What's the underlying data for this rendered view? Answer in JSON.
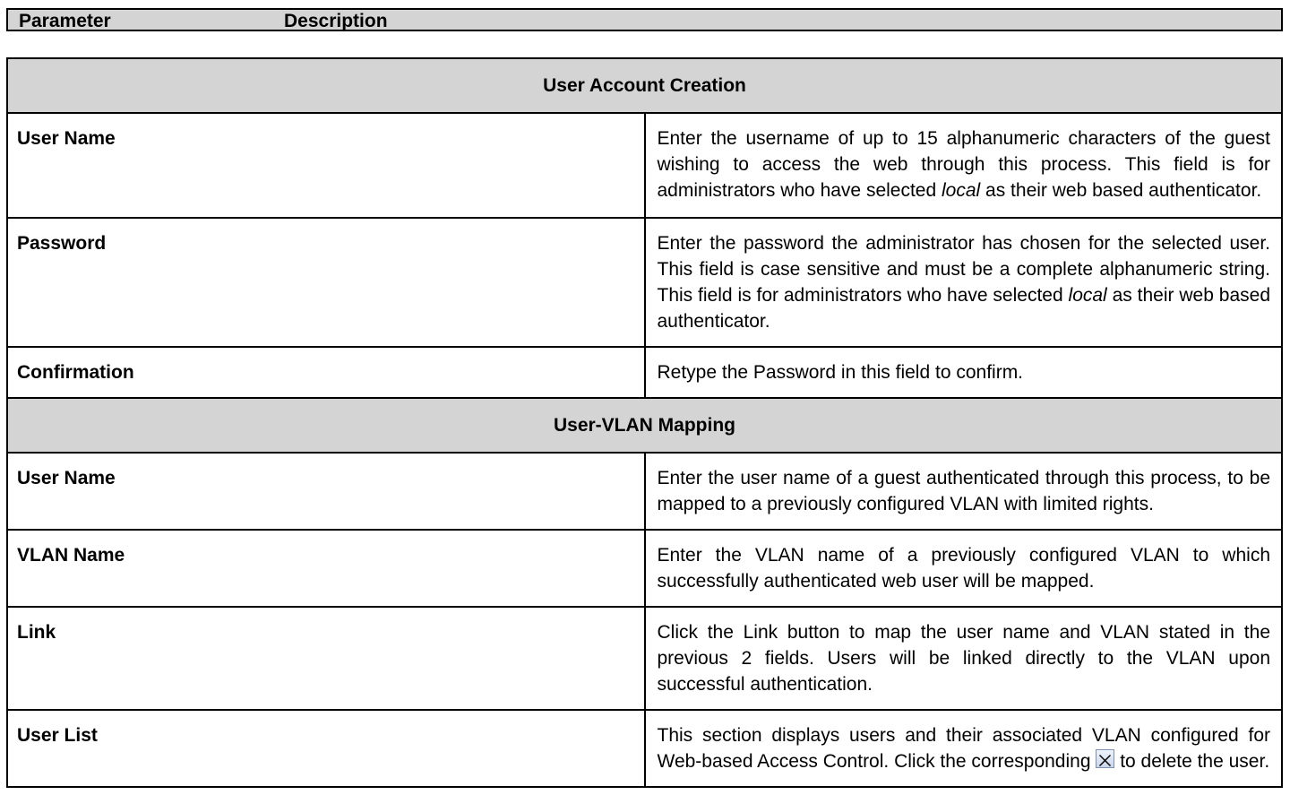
{
  "header": {
    "parameter": "Parameter",
    "description": "Description"
  },
  "sections": [
    {
      "title": "User Account Creation",
      "rows": [
        {
          "name": "User Name",
          "desc_1": "Enter the username of up to 15 alphanumeric characters of the guest wishing to access the web through this process. This field is for administrators who have selected ",
          "desc_em": "local",
          "desc_2": " as their web based authenticator."
        },
        {
          "name": "Password",
          "desc_1": "Enter the password the administrator has chosen for the selected user. This field is case sensitive and must be a complete alphanumeric string. This field is for administrators who have selected ",
          "desc_em": "local",
          "desc_2": " as their web based authenticator."
        },
        {
          "name": "Confirmation",
          "desc": "Retype the Password in this field to confirm."
        }
      ]
    },
    {
      "title": "User-VLAN Mapping",
      "rows": [
        {
          "name": "User Name",
          "desc": "Enter the user name of a guest authenticated through this process, to be mapped to a previously configured VLAN with limited rights."
        },
        {
          "name": "VLAN Name",
          "desc": "Enter the VLAN name of a previously configured VLAN to which successfully authenticated web user will be mapped."
        },
        {
          "name": "Link",
          "desc": "Click the Link button to map the user name and VLAN stated in the previous 2 fields. Users will be linked directly to the VLAN upon successful authentication."
        },
        {
          "name": "User List",
          "desc_1": "This section displays users and their associated VLAN configured for Web-based Access Control. Click the corresponding ",
          "icon": "delete-x-icon",
          "desc_2": " to delete the user."
        }
      ]
    }
  ]
}
